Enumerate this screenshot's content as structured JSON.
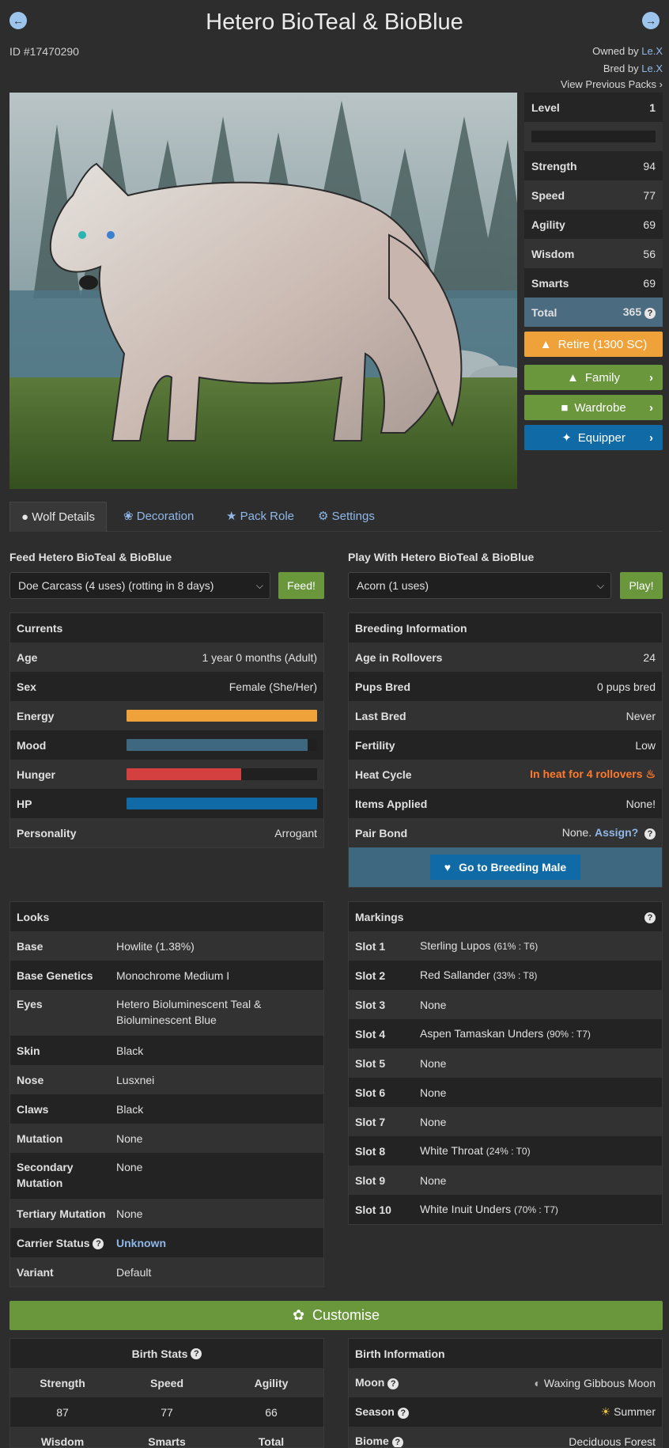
{
  "title": "Hetero BioTeal & BioBlue",
  "id_text": "ID #17470290",
  "owned_by_label": "Owned by",
  "owner": "Le.X",
  "bred_by_label": "Bred by",
  "breeder": "Le.X",
  "view_packs": "View Previous Packs",
  "stats": {
    "level_label": "Level",
    "level": "1",
    "rows": [
      {
        "label": "Strength",
        "value": "94"
      },
      {
        "label": "Speed",
        "value": "77"
      },
      {
        "label": "Agility",
        "value": "69"
      },
      {
        "label": "Wisdom",
        "value": "56"
      },
      {
        "label": "Smarts",
        "value": "69"
      }
    ],
    "total_label": "Total",
    "total": "365"
  },
  "actions": {
    "retire": "Retire (1300 SC)",
    "family": "Family",
    "wardrobe": "Wardrobe",
    "equipper": "Equipper"
  },
  "colors": {
    "orange": "#f0a23a",
    "green": "#6a963c",
    "blue": "#0f6aa6",
    "teal_total": "#4b6b80"
  },
  "tabs": [
    "Wolf Details",
    "Decoration",
    "Pack Role",
    "Settings"
  ],
  "feed": {
    "label": "Feed Hetero BioTeal & BioBlue",
    "selected": "Doe Carcass (4 uses) (rotting in 8 days)",
    "button": "Feed!"
  },
  "play": {
    "label": "Play With Hetero BioTeal & BioBlue",
    "selected": "Acorn (1 uses)",
    "button": "Play!"
  },
  "currents": {
    "title": "Currents",
    "age_label": "Age",
    "age": "1 year 0 months (Adult)",
    "sex_label": "Sex",
    "sex": "Female (She/Her)",
    "energy_label": "Energy",
    "energy": 1.0,
    "mood_label": "Mood",
    "mood": 0.95,
    "hunger_label": "Hunger",
    "hunger": 0.6,
    "hp_label": "HP",
    "hp": 1.0,
    "personality_label": "Personality",
    "personality": "Arrogant"
  },
  "breeding": {
    "title": "Breeding Information",
    "rows": [
      {
        "label": "Age in Rollovers",
        "value": "24"
      },
      {
        "label": "Pups Bred",
        "value": "0 pups bred"
      },
      {
        "label": "Last Bred",
        "value": "Never"
      },
      {
        "label": "Fertility",
        "value": "Low"
      }
    ],
    "heat_label": "Heat Cycle",
    "heat": "In heat for 4 rollovers",
    "items_label": "Items Applied",
    "items": "None!",
    "pair_label": "Pair Bond",
    "pair": "None.",
    "assign": "Assign?",
    "go_button": "Go to Breeding Male"
  },
  "looks": {
    "title": "Looks",
    "rows": [
      {
        "label": "Base",
        "value": "Howlite (1.38%)"
      },
      {
        "label": "Base Genetics",
        "value": "Monochrome Medium I"
      },
      {
        "label": "Eyes",
        "value": "Hetero Bioluminescent Teal & Bioluminescent Blue"
      },
      {
        "label": "Skin",
        "value": "Black"
      },
      {
        "label": "Nose",
        "value": "Lusxnei"
      },
      {
        "label": "Claws",
        "value": "Black"
      },
      {
        "label": "Mutation",
        "value": "None"
      },
      {
        "label": "Secondary Mutation",
        "value": "None"
      },
      {
        "label": "Tertiary Mutation",
        "value": "None"
      },
      {
        "label": "Carrier Status",
        "value": "Unknown"
      },
      {
        "label": "Variant",
        "value": "Default"
      }
    ]
  },
  "markings": {
    "title": "Markings",
    "rows": [
      {
        "label": "Slot 1",
        "value": "Sterling Lupos",
        "detail": "(61% : T6)"
      },
      {
        "label": "Slot 2",
        "value": "Red Sallander",
        "detail": "(33% : T8)"
      },
      {
        "label": "Slot 3",
        "value": "None",
        "detail": ""
      },
      {
        "label": "Slot 4",
        "value": "Aspen Tamaskan Unders",
        "detail": "(90% : T7)"
      },
      {
        "label": "Slot 5",
        "value": "None",
        "detail": ""
      },
      {
        "label": "Slot 6",
        "value": "None",
        "detail": ""
      },
      {
        "label": "Slot 7",
        "value": "None",
        "detail": ""
      },
      {
        "label": "Slot 8",
        "value": "White Throat",
        "detail": "(24% : T0)"
      },
      {
        "label": "Slot 9",
        "value": "None",
        "detail": ""
      },
      {
        "label": "Slot 10",
        "value": "White Inuit Unders",
        "detail": "(70% : T7)"
      }
    ]
  },
  "customise": "Customise",
  "birth_stats": {
    "title": "Birth Stats",
    "h1": "Strength",
    "h2": "Speed",
    "h3": "Agility",
    "v1": "87",
    "v2": "77",
    "v3": "66",
    "h4": "Wisdom",
    "h5": "Smarts",
    "h6": "Total"
  },
  "birth_info": {
    "title": "Birth Information",
    "moon_label": "Moon",
    "moon": "Waxing Gibbous Moon",
    "season_label": "Season",
    "season": "Summer",
    "biome_label": "Biome",
    "biome": "Deciduous Forest"
  }
}
